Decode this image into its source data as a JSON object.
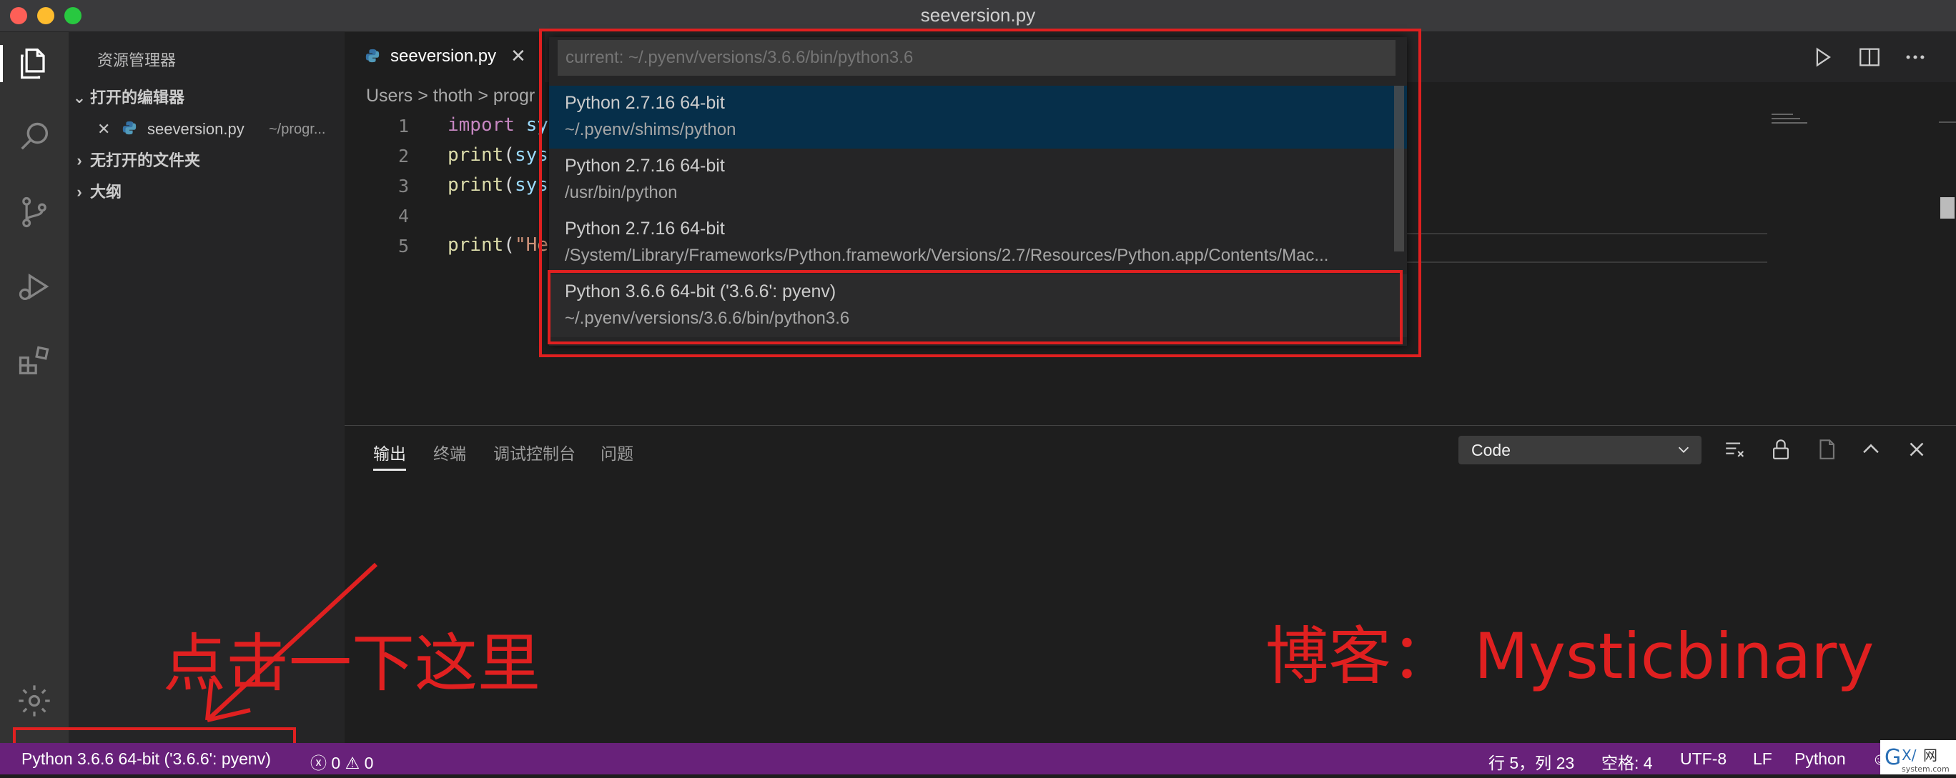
{
  "window": {
    "title": "seeversion.py"
  },
  "sidebar": {
    "header": "资源管理器",
    "open_editors": "打开的编辑器",
    "open_file": {
      "name": "seeversion.py",
      "path": "~/progr..."
    },
    "no_folder": "无打开的文件夹",
    "outline": "大纲"
  },
  "editor": {
    "tab_name": "seeversion.py",
    "breadcrumb": "Users  >  thoth  >  progr",
    "line_numbers": [
      "1",
      "2",
      "3",
      "4",
      "5"
    ]
  },
  "quickpick": {
    "current": "current: ~/.pyenv/versions/3.6.6/bin/python3.6",
    "items": [
      {
        "label": "Python 2.7.16 64-bit",
        "detail": "~/.pyenv/shims/python"
      },
      {
        "label": "Python 2.7.16 64-bit",
        "detail": "/usr/bin/python"
      },
      {
        "label": "Python 2.7.16 64-bit",
        "detail": "/System/Library/Frameworks/Python.framework/Versions/2.7/Resources/Python.app/Contents/Mac..."
      },
      {
        "label": "Python 3.6.6 64-bit ('3.6.6': pyenv)",
        "detail": "~/.pyenv/versions/3.6.6/bin/python3.6"
      }
    ]
  },
  "panel": {
    "tabs": [
      "输出",
      "终端",
      "调试控制台",
      "问题"
    ],
    "output_channel": "Code"
  },
  "statusbar": {
    "interpreter": "Python 3.6.6 64-bit ('3.6.6': pyenv)",
    "errors": "0",
    "warnings": "0",
    "position": "行 5，列 23",
    "spaces": "空格: 4",
    "encoding": "UTF-8",
    "eol": "LF",
    "language": "Python"
  },
  "annotations": {
    "click_here": "点击一下这里",
    "blog": "博客： Mysticbinary"
  },
  "colors": {
    "statusbar": "#68217a",
    "annotation": "#e02020",
    "selected_item": "#062f4a"
  }
}
